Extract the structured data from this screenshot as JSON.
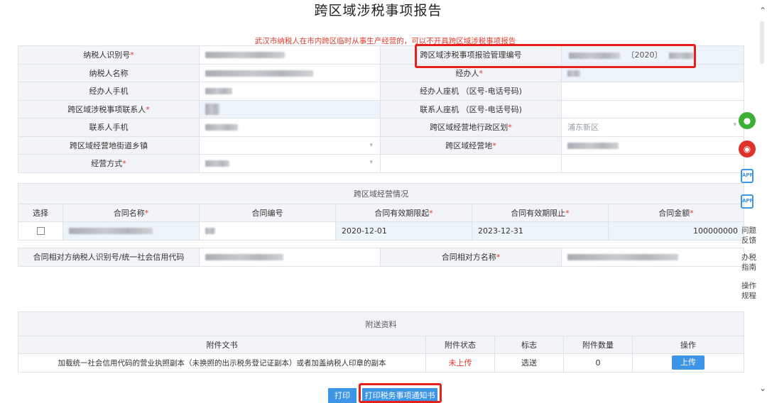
{
  "page": {
    "title": "跨区域涉税事项报告",
    "notice": "武汉市纳税人在市内跨区临时从事生产经营的，可以不开具跨区域涉税事项报告"
  },
  "form": {
    "taxpayer_id_label": "纳税人识别号",
    "report_number_label": "跨区域涉税事项报验管理编号",
    "report_number_year": "〔2020〕",
    "taxpayer_name_label": "纳税人名称",
    "handler_label": "经办人",
    "handler_phone_label": "经办人手机",
    "handler_landline_label": "经办人座机 （区号-电话号码)",
    "contact_label": "跨区域涉税事项联系人",
    "contact_landline_label": "联系人座机 （区号-电话号码)",
    "contact_phone_label": "联系人手机",
    "admin_region_label": "跨区域经营地行政区划",
    "admin_region_value": "浦东新区",
    "street_label": "跨区域经营地街道乡镇",
    "location_label": "跨区域经营地",
    "mode_label": "经营方式",
    "required_mark": "*"
  },
  "business": {
    "section_title": "跨区域经营情况",
    "columns": [
      "选择",
      "合同名称",
      "合同编号",
      "合同有效期限起",
      "合同有效期限止",
      "合同金额"
    ],
    "required_cols": [
      false,
      true,
      false,
      true,
      true,
      true
    ],
    "rows": [
      {
        "start": "2020-12-01",
        "end": "2023-12-31",
        "amount": "100000000"
      }
    ],
    "counterparty_id_label": "合同相对方纳税人识别号/统一社会信用代码",
    "counterparty_name_label": "合同相对方名称"
  },
  "attachments": {
    "section_title": "附送资料",
    "columns": [
      "附件文书",
      "附件状态",
      "标志",
      "附件数量",
      "操作"
    ],
    "rows": [
      {
        "doc": "加载统一社会信用代码的营业执照副本（未换照的出示税务登记证副本）或者加盖纳税人印章的副本",
        "status": "未上传",
        "flag": "选送",
        "count": "0",
        "action": "上传"
      }
    ]
  },
  "buttons": {
    "print": "打印",
    "print_notice": "打印税务事项通知书"
  },
  "side_rail": {
    "icons": [
      "wechat-icon",
      "weibo-icon",
      "app-icon",
      "app-icon"
    ],
    "app_text": "APP",
    "feedback": "问题反馈",
    "guide": "办税指南",
    "rules": "操作规程"
  },
  "colors": {
    "accent": "#3d95e8",
    "highlight": "#e8201a",
    "required": "#e23b2e",
    "label_bg": "#f2f4f7"
  }
}
